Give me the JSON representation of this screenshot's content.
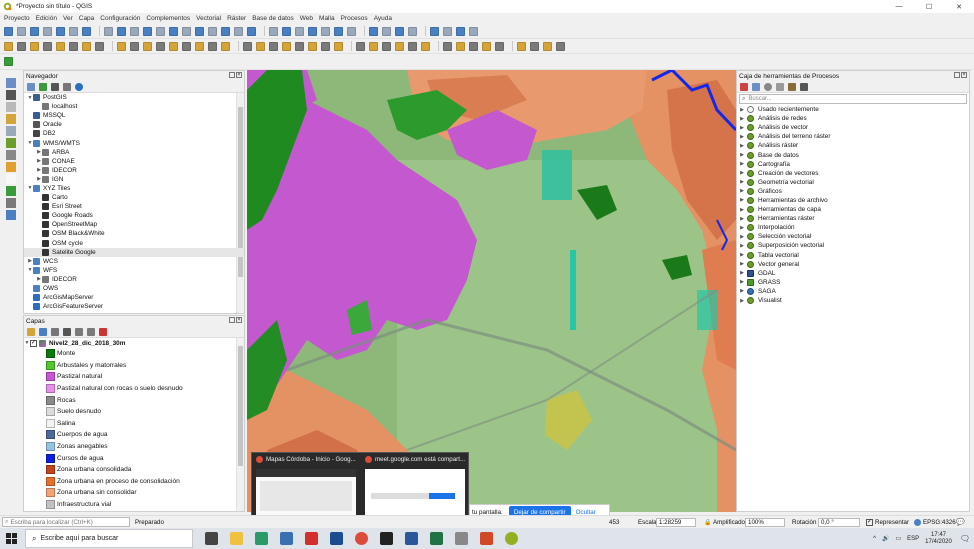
{
  "window": {
    "title": "*Proyecto sin título - QGIS"
  },
  "menu": [
    "Proyecto",
    "Edición",
    "Ver",
    "Capa",
    "Configuración",
    "Complementos",
    "Vectorial",
    "Ráster",
    "Base de datos",
    "Web",
    "Malla",
    "Procesos",
    "Ayuda"
  ],
  "navigator": {
    "title": "Navegador",
    "items": [
      {
        "label": "PostGIS",
        "level": 0,
        "expanded": true,
        "icon": "elephant-icon"
      },
      {
        "label": "localhost",
        "level": 1,
        "icon": "connection-icon"
      },
      {
        "label": "MSSQL",
        "level": 0,
        "icon": "mssql-icon"
      },
      {
        "label": "Oracle",
        "level": 0,
        "icon": "oracle-icon"
      },
      {
        "label": "DB2",
        "level": 0,
        "icon": "db2-icon"
      },
      {
        "label": "WMS/WMTS",
        "level": 0,
        "expanded": true,
        "icon": "globe-icon"
      },
      {
        "label": "ARBA",
        "level": 1,
        "collapsed": true,
        "icon": "connection-icon"
      },
      {
        "label": "CONAE",
        "level": 1,
        "collapsed": true,
        "icon": "connection-icon"
      },
      {
        "label": "IDECOR",
        "level": 1,
        "collapsed": true,
        "icon": "connection-icon"
      },
      {
        "label": "IGN",
        "level": 1,
        "collapsed": true,
        "icon": "connection-icon"
      },
      {
        "label": "XYZ Tiles",
        "level": 0,
        "expanded": true,
        "icon": "tiles-icon"
      },
      {
        "label": "Carto",
        "level": 1,
        "icon": "grid-icon"
      },
      {
        "label": "Esri Street",
        "level": 1,
        "icon": "grid-icon"
      },
      {
        "label": "Google Roads",
        "level": 1,
        "icon": "grid-icon"
      },
      {
        "label": "OpenStreetMap",
        "level": 1,
        "icon": "grid-icon"
      },
      {
        "label": "OSM Black&White",
        "level": 1,
        "icon": "grid-icon"
      },
      {
        "label": "OSM cycle",
        "level": 1,
        "icon": "grid-icon"
      },
      {
        "label": "Satelite Google",
        "level": 1,
        "icon": "grid-icon",
        "selected": true
      },
      {
        "label": "WCS",
        "level": 0,
        "collapsed": true,
        "icon": "globe-icon"
      },
      {
        "label": "WFS",
        "level": 0,
        "expanded": true,
        "icon": "globe-icon"
      },
      {
        "label": "IDECOR",
        "level": 1,
        "collapsed": true,
        "icon": "connection-icon"
      },
      {
        "label": "OWS",
        "level": 0,
        "icon": "globe-icon"
      },
      {
        "label": "ArcGisMapServer",
        "level": 0,
        "icon": "arcgis-icon"
      },
      {
        "label": "ArcGisFeatureServer",
        "level": 0,
        "icon": "arcgis-icon"
      }
    ]
  },
  "layers": {
    "title": "Capas",
    "layer_name": "Nivel2_28_dic_2018_30m",
    "legend": [
      {
        "label": "Monte",
        "color": "#0b7a0b"
      },
      {
        "label": "Arbustales y matorrales",
        "color": "#4fc72c"
      },
      {
        "label": "Pastizal natural",
        "color": "#c855d6"
      },
      {
        "label": "Pastizal natural con rocas o suelo desnudo",
        "color": "#e98ee9"
      },
      {
        "label": "Rocas",
        "color": "#8a8a8a"
      },
      {
        "label": "Suelo desnudo",
        "color": "#dcdcdc"
      },
      {
        "label": "Salina",
        "color": "#f3f3f3"
      },
      {
        "label": "Cuerpos de agua",
        "color": "#4a6a9a"
      },
      {
        "label": "Zonas anegables",
        "color": "#93c5e0"
      },
      {
        "label": "Cursos de agua",
        "color": "#0a1fe0"
      },
      {
        "label": "Zona urbana consolidada",
        "color": "#c0441e"
      },
      {
        "label": "Zona urbana en proceso de consolidación",
        "color": "#e8702d"
      },
      {
        "label": "Zona urbana sin consolidar",
        "color": "#f4a374"
      },
      {
        "label": "Infraestructura vial",
        "color": "#c2c2c2"
      }
    ]
  },
  "toolbox": {
    "title": "Caja de herramientas de Procesos",
    "search_placeholder": "Buscar...",
    "items": [
      {
        "label": "Usado recientemente",
        "icon": "clock-icon"
      },
      {
        "label": "Análisis de redes",
        "icon": "qgis-icon"
      },
      {
        "label": "Análisis de vector",
        "icon": "qgis-icon"
      },
      {
        "label": "Análisis del terreno ráster",
        "icon": "qgis-icon"
      },
      {
        "label": "Análisis ráster",
        "icon": "qgis-icon"
      },
      {
        "label": "Base de datos",
        "icon": "qgis-icon"
      },
      {
        "label": "Cartografía",
        "icon": "qgis-icon"
      },
      {
        "label": "Creación de vectores",
        "icon": "qgis-icon"
      },
      {
        "label": "Geometría vectorial",
        "icon": "qgis-icon"
      },
      {
        "label": "Gráficos",
        "icon": "qgis-icon"
      },
      {
        "label": "Herramientas de archivo",
        "icon": "qgis-icon"
      },
      {
        "label": "Herramientas de capa",
        "icon": "qgis-icon"
      },
      {
        "label": "Herramientas ráster",
        "icon": "qgis-icon"
      },
      {
        "label": "Interpolación",
        "icon": "qgis-icon"
      },
      {
        "label": "Selección vectorial",
        "icon": "qgis-icon"
      },
      {
        "label": "Superposición vectorial",
        "icon": "qgis-icon"
      },
      {
        "label": "Tabla vectorial",
        "icon": "qgis-icon"
      },
      {
        "label": "Vector general",
        "icon": "qgis-icon"
      },
      {
        "label": "GDAL",
        "icon": "gdal-icon"
      },
      {
        "label": "GRASS",
        "icon": "grass-icon"
      },
      {
        "label": "SAGA",
        "icon": "saga-icon"
      },
      {
        "label": "Visualist",
        "icon": "qgis-icon"
      }
    ]
  },
  "statusbar": {
    "locator_placeholder": "Escriba para localizar (Ctrl+K)",
    "status": "Preparado",
    "coord_fragment": "453",
    "scale_label": "Escala",
    "scale": "1:28259",
    "magnifier_label": "Amplificador",
    "magnifier": "100%",
    "rotation_label": "Rotación",
    "rotation": "0,0 °",
    "render_label": "Representar",
    "crs": "EPSG:4326"
  },
  "meet": {
    "fragment": "tu pantalla.",
    "share_label": "Dejar de compartir",
    "hide_label": "Ocultar"
  },
  "previews": [
    {
      "title": "Mapas Córdoba - Inicio - Goog..."
    },
    {
      "title": "meet.google.com está compart..."
    }
  ],
  "taskbar": {
    "search_placeholder": "Escribe aquí para buscar",
    "language": "ESP",
    "time": "17:47",
    "date": "17/4/2020"
  }
}
